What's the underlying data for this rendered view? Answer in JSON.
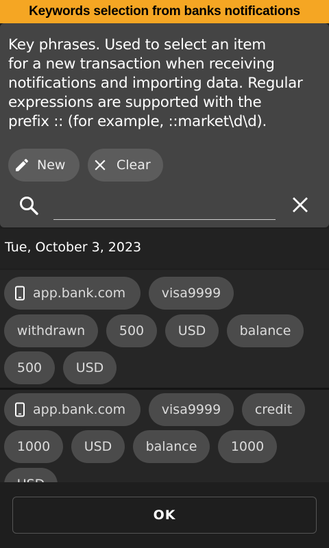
{
  "title": "Keywords selection from banks notifications",
  "description_lines": [
    "Key phrases. Used to select an item",
    "for a new transaction when receiving",
    "notifications and importing data. Regular",
    "expressions are supported with the",
    "prefix :: (for example, ::market\\d\\d)."
  ],
  "actions": {
    "new_label": "New",
    "new_icon": "pencil-icon",
    "clear_label": "Clear",
    "clear_icon": "close-icon"
  },
  "search": {
    "placeholder": "",
    "value": "",
    "search_icon": "search-icon",
    "clear_icon": "close-icon"
  },
  "date_header": "Tue, October 3, 2023",
  "groups": [
    {
      "source_icon": "phone-icon",
      "chips": [
        "app.bank.com",
        "visa9999",
        "withdrawn",
        "500",
        "USD",
        "balance",
        "500",
        "USD"
      ]
    },
    {
      "source_icon": "phone-icon",
      "chips": [
        "app.bank.com",
        "visa9999",
        "credit",
        "1000",
        "USD",
        "balance",
        "1000",
        "USD"
      ]
    }
  ],
  "ok_label": "OK",
  "colors": {
    "title_background": "#f5a623",
    "panel_background": "#444444",
    "chip_background": "#4b4b4b",
    "app_background": "#1e1e1e"
  }
}
